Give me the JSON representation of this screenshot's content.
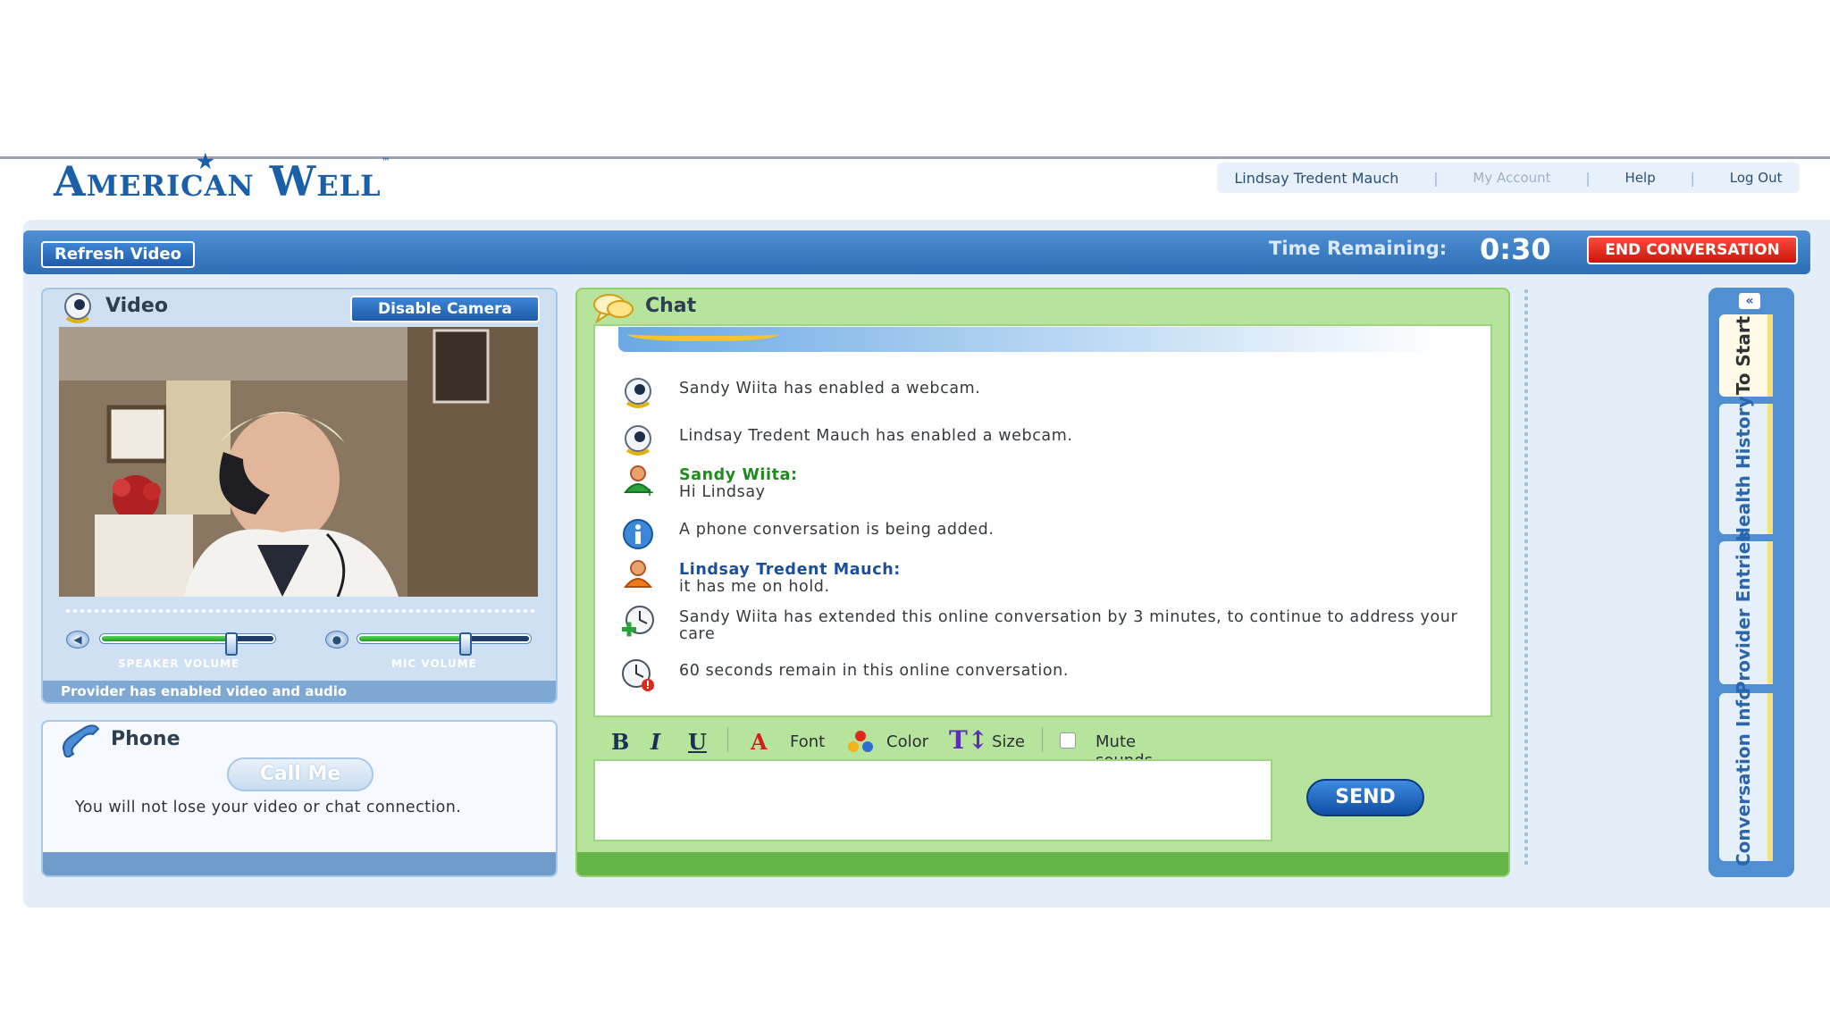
{
  "header": {
    "logo_text": "American Well",
    "user_name": "Lindsay Tredent Mauch",
    "nav": [
      "My Account",
      "Help",
      "Log Out"
    ]
  },
  "toolbar": {
    "refresh_label": "Refresh Video",
    "time_label": "Time Remaining:",
    "time_value": "0:30",
    "end_label": "END CONVERSATION"
  },
  "video": {
    "title": "Video",
    "disable_label": "Disable Camera",
    "speaker_label": "SPEAKER VOLUME",
    "speaker_level": 0.76,
    "mic_label": "MIC VOLUME",
    "mic_level": 0.63,
    "status": "Provider has enabled video and audio"
  },
  "phone": {
    "title": "Phone",
    "call_label": "Call Me",
    "note": "You will not lose your video or chat connection."
  },
  "chat": {
    "title": "Chat",
    "messages": [
      {
        "text": "Sandy Wiita has enabled a webcam."
      },
      {
        "text": "Lindsay Tredent Mauch has enabled a webcam."
      },
      {
        "sender": "Sandy Wiita:",
        "text": "Hi Lindsay"
      },
      {
        "text": "A phone conversation is being added."
      },
      {
        "sender": "Lindsay Tredent Mauch:",
        "text": "it has me on hold."
      },
      {
        "text": "Sandy Wiita has extended this online conversation by 3 minutes, to continue to address your care"
      },
      {
        "text": "60 seconds remain in this online conversation."
      }
    ],
    "format": {
      "bold": "B",
      "italic": "I",
      "underline": "U",
      "font": "Font",
      "color": "Color",
      "size": "Size",
      "mute": "Mute sounds"
    },
    "send_label": "SEND"
  },
  "side_tabs": [
    "To Start",
    "Health History",
    "Provider Entries",
    "Conversation Info"
  ],
  "colors": {
    "brand_blue": "#1b5fa8",
    "chat_green": "#b7e49d",
    "end_red": "#e0281b"
  }
}
